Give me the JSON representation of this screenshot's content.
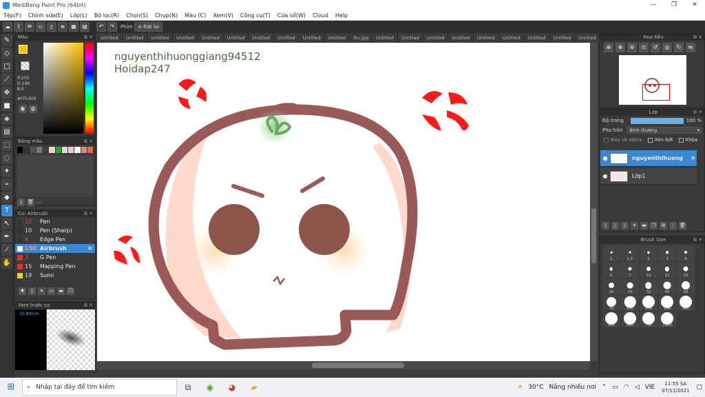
{
  "window": {
    "title": "MediBang Paint Pro (64bit)"
  },
  "menu": [
    "Tệp(F)",
    "Chỉnh sửa(E)",
    "Lớp(L)",
    "Bộ lọc(R)",
    "Chọn(S)",
    "Chụp(N)",
    "Màu (C)",
    "Xem(V)",
    "Công cụ(T)",
    "Cửa sổ(W)",
    "Cloud",
    "Help"
  ],
  "toolbar": {
    "phim_label": "Phím",
    "reset_label": "Đặt lại"
  },
  "color_panel": {
    "title": "Màu",
    "r": "R:255",
    "g": "G:196",
    "b": "B:0",
    "hex": "#FFC400",
    "fg_color": "#FFC400"
  },
  "palette_panel": {
    "title": "Bảng màu",
    "colors": [
      "#000000",
      "#333333",
      "#555555",
      "#777777",
      "#4a3a3a",
      "#e8d8c8",
      "#22aa22",
      "#dddddd",
      "#f2c8c8",
      "#ffffff",
      "#e08878",
      "#ff6040"
    ],
    "footer_text": "---"
  },
  "brush_panel": {
    "title": "Cọ: Airbrush",
    "items": [
      {
        "size": "12",
        "name": "Pen",
        "color": "#333333"
      },
      {
        "size": "10",
        "name": "Pen (Sharp)",
        "color": "#333333"
      },
      {
        "size": "4",
        "name": "Edge Pen",
        "color": "#333333"
      },
      {
        "size": "150",
        "name": "Airbrush",
        "color": "#ffffff"
      },
      {
        "size": "3",
        "name": "G Pen",
        "color": "#e03030"
      },
      {
        "size": "15",
        "name": "Mapping Pen",
        "color": "#e03030"
      },
      {
        "size": "19",
        "name": "Sumi",
        "color": "#e8d020"
      }
    ]
  },
  "preview_panel": {
    "title": "Xem trước cọ",
    "size": "10.89mm"
  },
  "tabs": [
    "Untitled",
    "Untitled",
    "Untitled",
    "Untitled",
    "Untitled",
    "Untitled",
    "Untitled",
    "Untitled",
    "Untitled",
    "Untitled",
    "tkc.jpg",
    "Untitled",
    "Untitled",
    "Untitled",
    "Untitled",
    "Untitled",
    "Untitled",
    "Untitled",
    "Untitled",
    "Untitled",
    "Untitled",
    "Untitled",
    "Untitled",
    "Untitled"
  ],
  "canvas": {
    "watermark_line1": "nguyenthihuonggiang94512",
    "watermark_line2": "Hoidap247"
  },
  "navigator_panel": {
    "title": "Hoa tiêu"
  },
  "layer_panel": {
    "title": "Lớp",
    "opacity_label": "Độ trong",
    "opacity_value": "100 %",
    "opacity_percent": 100,
    "blend_label": "Pha trộn",
    "blend_value": "Bình thường",
    "protect_alpha": "Bảo vệ alpha",
    "clipping": "Xén bớt",
    "lock": "Khóa",
    "layers": [
      {
        "name": "nguyenthihuong",
        "selected": true
      },
      {
        "name": "Lớp1",
        "selected": false
      }
    ]
  },
  "brushsize_panel": {
    "title": "Brush Size",
    "sizes": [
      "1",
      "1.5",
      "2",
      "3",
      "4",
      "5",
      "7",
      "10",
      "12",
      "15",
      "20",
      "25",
      "30",
      "40",
      "50",
      "70",
      "100",
      "150",
      "200",
      "300",
      "400",
      "500",
      "700",
      "1000"
    ]
  },
  "taskbar": {
    "search_placeholder": "Nhập tại đây để tìm kiếm",
    "weather_temp": "30°C",
    "weather_text": "Nắng nhiều nơi",
    "lang": "VIE",
    "time": "11:55 SA",
    "date": "07/11/2021"
  }
}
